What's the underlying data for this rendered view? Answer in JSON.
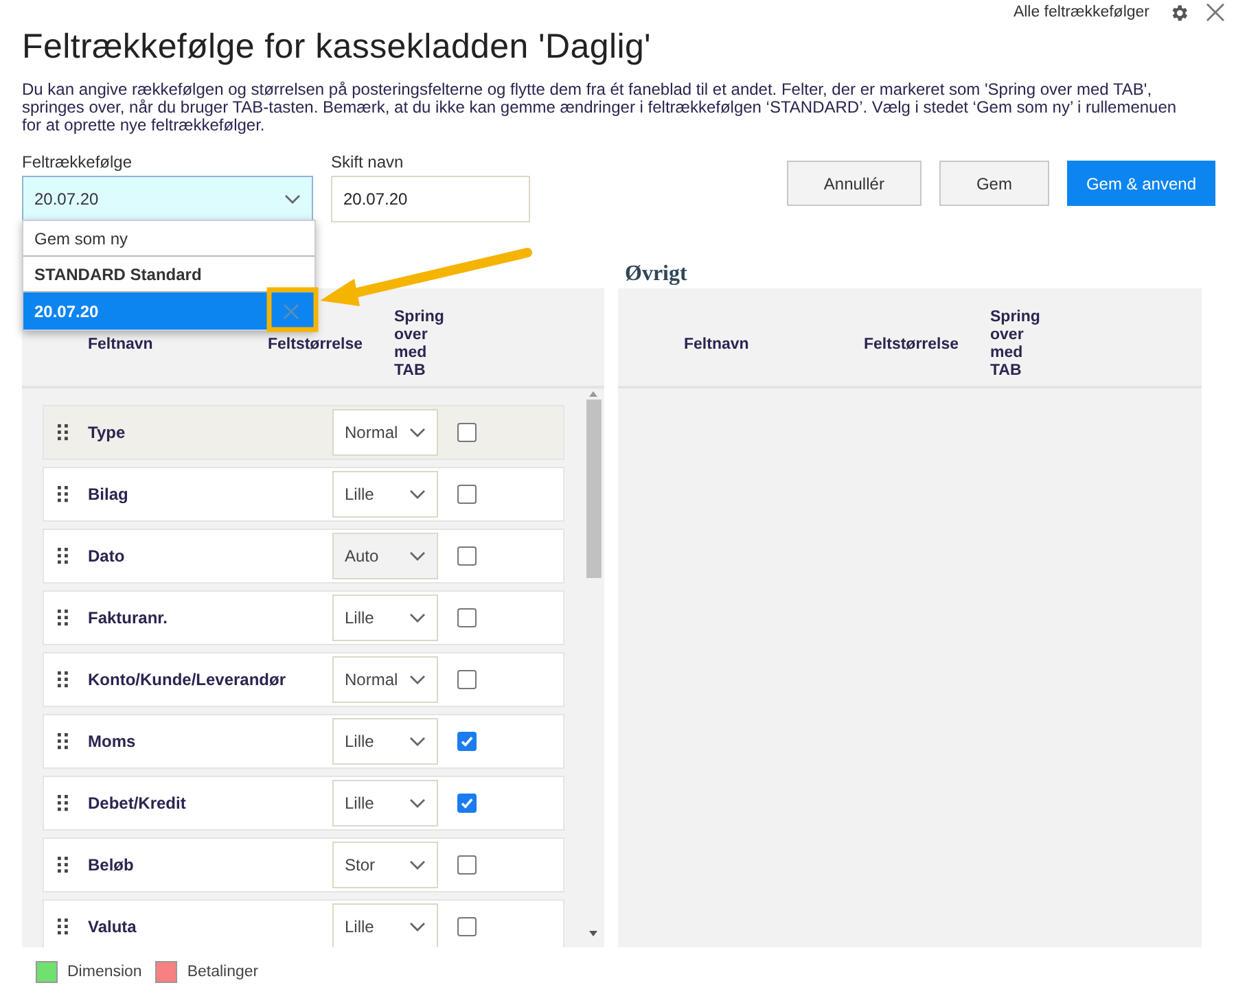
{
  "header": {
    "link": "Alle feltrækkefølger"
  },
  "title": "Feltrækkefølge for kassekladden 'Daglig'",
  "description": "Du kan angive rækkefølgen og størrelsen på posteringsfelterne og flytte dem fra ét faneblad til et andet. Felter, der er markeret som 'Spring over med TAB', springes over, når du bruger TAB-tasten. Bemærk, at du ikke kan gemme ændringer i feltrækkefølgen ‘STANDARD’. Vælg i stedet ‘Gem som ny’ i rullemenuen for at oprette nye feltrækkefølger.",
  "layout_field": {
    "label": "Feltrækkefølge",
    "value": "20.07.20",
    "expanded": true,
    "options": [
      {
        "label": "Gem som ny",
        "kind": "action",
        "selected": false
      },
      {
        "label": "STANDARD Standard",
        "kind": "preset",
        "selected": false
      },
      {
        "label": "20.07.20",
        "kind": "custom",
        "selected": true
      }
    ]
  },
  "name_field": {
    "label": "Skift navn",
    "value": "20.07.20"
  },
  "buttons": [
    {
      "label": "Annullér",
      "primary": false
    },
    {
      "label": "Gem",
      "primary": false
    },
    {
      "label": "Gem & anvend",
      "primary": true
    }
  ],
  "panels": [
    {
      "columns": [
        "Feltnavn",
        "Feltstørrelse",
        "Spring over med TAB"
      ],
      "rows": [
        {
          "name": "Type",
          "size": "Normal",
          "size_disabled": false,
          "skip_tab": false,
          "selected": true
        },
        {
          "name": "Bilag",
          "size": "Lille",
          "size_disabled": false,
          "skip_tab": false,
          "selected": false
        },
        {
          "name": "Dato",
          "size": "Auto",
          "size_disabled": true,
          "skip_tab": false,
          "selected": false
        },
        {
          "name": "Fakturanr.",
          "size": "Lille",
          "size_disabled": false,
          "skip_tab": false,
          "selected": false
        },
        {
          "name": "Konto/Kunde/Leverandør",
          "size": "Normal",
          "size_disabled": false,
          "skip_tab": false,
          "selected": false
        },
        {
          "name": "Moms",
          "size": "Lille",
          "size_disabled": false,
          "skip_tab": true,
          "selected": false
        },
        {
          "name": "Debet/Kredit",
          "size": "Lille",
          "size_disabled": false,
          "skip_tab": true,
          "selected": false
        },
        {
          "name": "Beløb",
          "size": "Stor",
          "size_disabled": false,
          "skip_tab": false,
          "selected": false
        },
        {
          "name": "Valuta",
          "size": "Lille",
          "size_disabled": false,
          "skip_tab": false,
          "selected": false
        }
      ]
    },
    {
      "title": "Øvrigt",
      "columns": [
        "Feltnavn",
        "Feltstørrelse",
        "Spring over med TAB"
      ]
    }
  ],
  "legend": [
    {
      "label": "Dimension",
      "color": "#70e070"
    },
    {
      "label": "Betalinger",
      "color": "#f88080"
    }
  ]
}
